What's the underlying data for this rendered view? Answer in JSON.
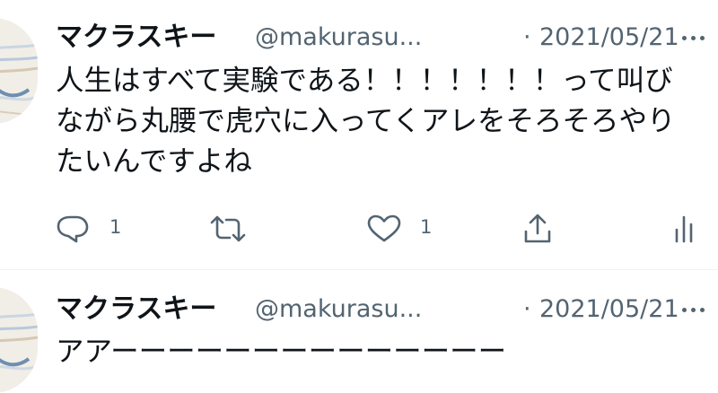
{
  "tweets": [
    {
      "author_name": "マクラスキー",
      "handle": "@makurasu...",
      "separator": "·",
      "date": "2021/05/21",
      "text": "人生はすべて実験である！！！！！！！って叫びながら丸腰で虎穴に入ってくアレをそろそろやりたいんですよね",
      "reply_count": "1",
      "retweet_count": "",
      "like_count": "1"
    },
    {
      "author_name": "マクラスキー",
      "handle": "@makurasu...",
      "separator": "·",
      "date": "2021/05/21",
      "text": "アアーーーーーーーーーーーーーー"
    }
  ],
  "icons": {
    "more": "more-horizontal-icon",
    "reply": "reply-icon",
    "retweet": "retweet-icon",
    "like": "heart-icon",
    "share": "share-icon",
    "analytics": "analytics-icon"
  },
  "colors": {
    "text": "#0f1419",
    "secondary": "#536471",
    "divider": "#eff3f4"
  }
}
